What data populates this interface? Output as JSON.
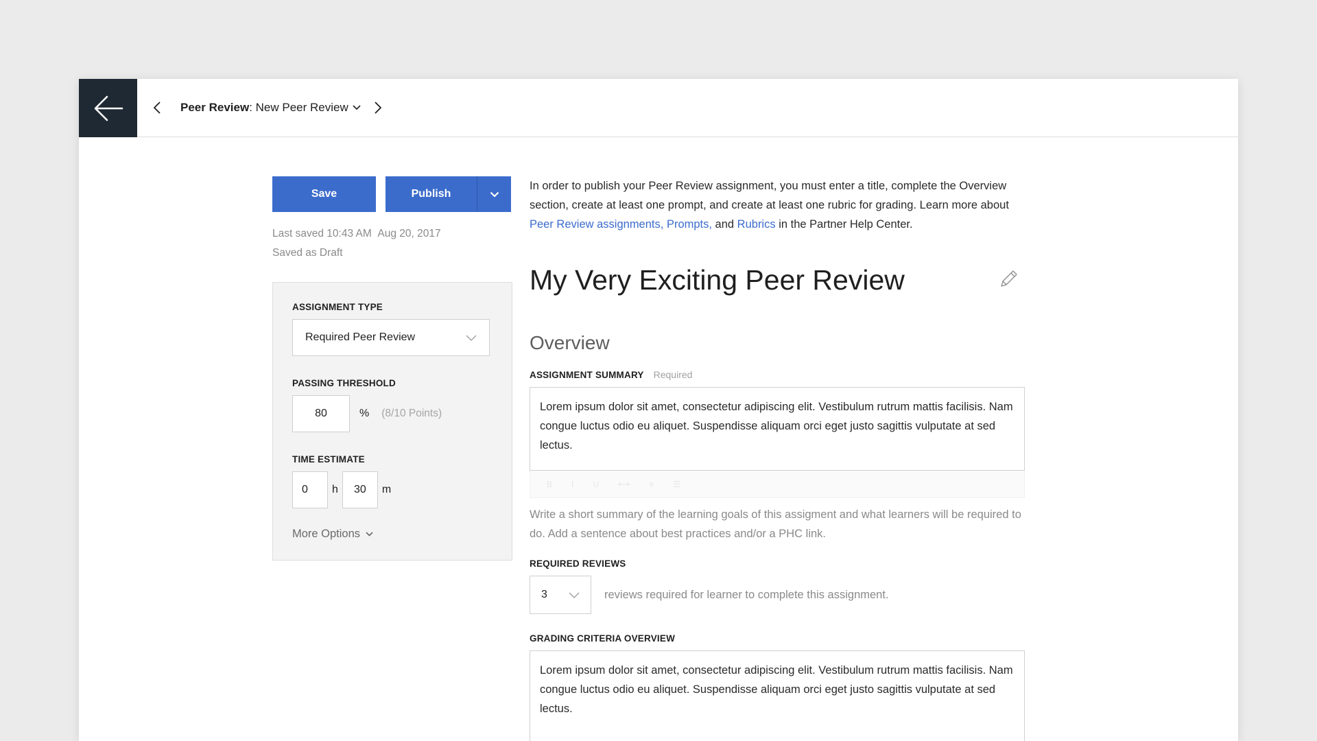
{
  "breadcrumb": {
    "type_label": "Peer Review",
    "separator": ":",
    "item_label": "New Peer Review"
  },
  "actions": {
    "save_label": "Save",
    "publish_label": "Publish"
  },
  "status": {
    "last_saved_prefix": "Last saved",
    "last_saved_time": "10:43 AM",
    "last_saved_date": "Aug 20, 2017",
    "state": "Saved as Draft"
  },
  "settings": {
    "assignment_type_label": "ASSIGNMENT TYPE",
    "assignment_type_value": "Required Peer Review",
    "passing_threshold_label": "PASSING THRESHOLD",
    "passing_threshold_value": "80",
    "percent_sign": "%",
    "points_hint": "(8/10 Points)",
    "time_estimate_label": "TIME ESTIMATE",
    "hours_value": "0",
    "hours_unit": "h",
    "minutes_value": "30",
    "minutes_unit": "m",
    "more_options_label": "More Options"
  },
  "intro": {
    "text_1": "In order to publish your Peer Review assignment, you must enter a title, complete the Overview section, create at least one prompt, and create at least one rubric for grading. Learn more about ",
    "link_1": "Peer Review assignments,",
    "link_2": "Prompts,",
    "text_and": " and ",
    "link_3": "Rubrics",
    "text_2": " in the Partner Help Center."
  },
  "title": "My Very Exciting Peer Review",
  "overview": {
    "heading": "Overview",
    "summary_label": "ASSIGNMENT SUMMARY",
    "summary_required": "Required",
    "summary_text": "Lorem ipsum dolor sit amet, consectetur adipiscing elit. Vestibulum rutrum mattis facilisis. Nam congue luctus odio eu aliquet. Suspendisse aliquam orci eget justo sagittis vulputate at sed lectus.",
    "summary_help": "Write a short summary of the learning goals of this assigment and what learners will be required to do. Add a sentence about best practices and/or a PHC link.",
    "required_reviews_label": "REQUIRED REVIEWS",
    "required_reviews_value": "3",
    "required_reviews_text": "reviews required for learner to complete this assignment.",
    "grading_label": "GRADING CRITERIA OVERVIEW",
    "grading_text": "Lorem ipsum dolor sit amet, consectetur adipiscing elit. Vestibulum rutrum mattis facilisis. Nam congue luctus odio eu aliquet. Suspendisse aliquam orci eget justo sagittis vulputate at sed lectus."
  },
  "colors": {
    "accent": "#3b6ccc",
    "back_button_bg": "#1f2933",
    "page_bg": "#ebebeb"
  }
}
